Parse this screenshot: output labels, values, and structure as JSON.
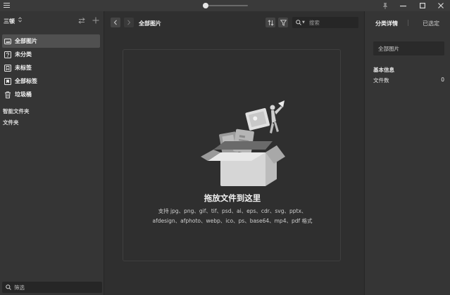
{
  "titlebar": {
    "icons": [
      "menu-icon",
      "pin-icon",
      "minimize-icon",
      "maximize-icon",
      "close-icon"
    ],
    "zoom_fraction": 0.0
  },
  "sidebar": {
    "library_name": "三顿",
    "library_caret": "⌃⌄",
    "items": [
      {
        "label": "全部图片",
        "icon": "all-images-icon",
        "active": true
      },
      {
        "label": "未分类",
        "icon": "uncategorized-icon",
        "active": false
      },
      {
        "label": "未标签",
        "icon": "untagged-icon",
        "active": false
      },
      {
        "label": "全部标签",
        "icon": "all-tags-icon",
        "active": false
      },
      {
        "label": "垃圾桶",
        "icon": "trash-icon",
        "active": false
      }
    ],
    "smart_folders_label": "智能文件夹",
    "folders_label": "文件夹",
    "filter_placeholder": "筛选"
  },
  "main": {
    "breadcrumb": "全部图片",
    "search_placeholder": "搜索",
    "drop_title": "拖放文件到这里",
    "drop_desc": "支持 jpg、png、gif、tif、psd、ai、eps、cdr、svg、pptx、afdesign、afphoto、webp、ico、ps、base64、mp4、pdf 格式"
  },
  "inspector": {
    "tab_details": "分类详情",
    "tab_selected": "已选定",
    "folder_name": "全部图片",
    "info_heading": "基本信息",
    "file_count_label": "文件数",
    "file_count_value": "0"
  },
  "colors": {
    "background": "#2e2e2e",
    "sidebar": "#353535",
    "active_item": "#505050",
    "text": "#f0f0f0"
  }
}
